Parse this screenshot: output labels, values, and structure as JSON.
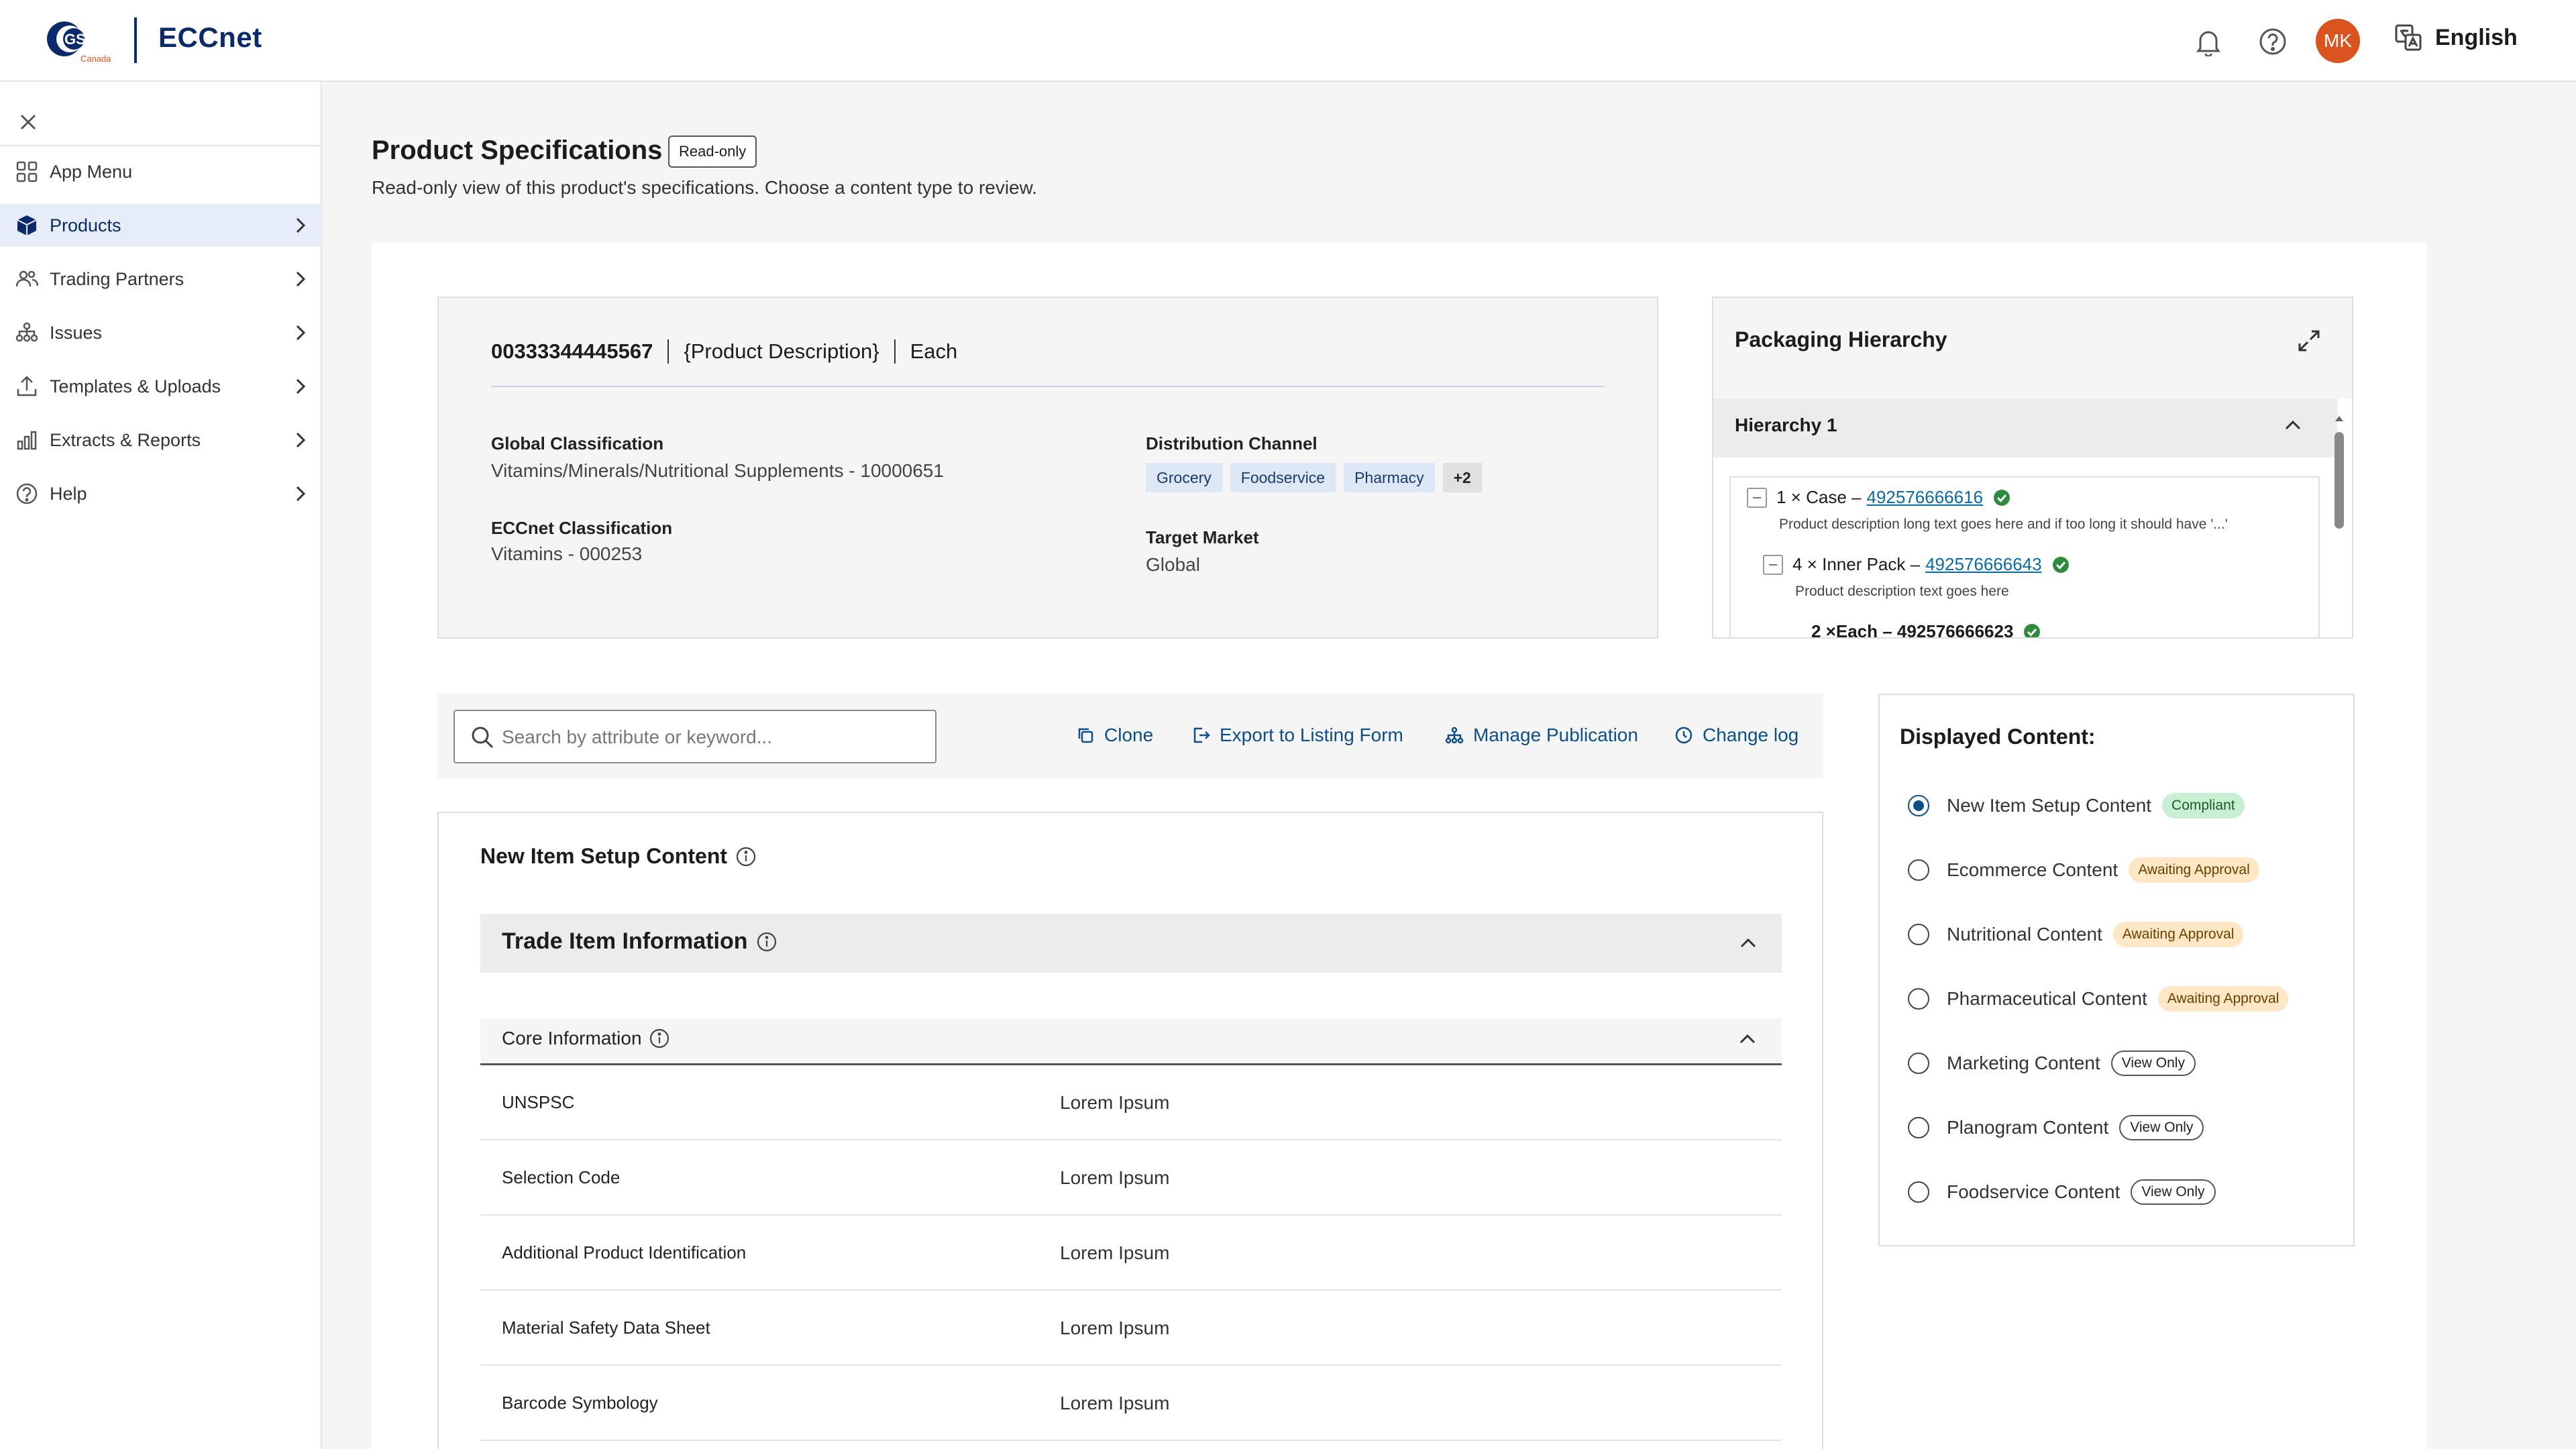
{
  "header": {
    "logo_text": "GS1",
    "logo_sub": "Canada",
    "app_name": "ECCnet",
    "avatar_initials": "MK",
    "language": "English",
    "icons": [
      "bell-icon",
      "help-icon",
      "translate-icon"
    ]
  },
  "sidebar": {
    "items": [
      {
        "label": "App Menu",
        "icon": "grid-icon",
        "has_chevron": false
      },
      {
        "label": "Products",
        "icon": "cube-icon",
        "has_chevron": true,
        "active": true
      },
      {
        "label": "Trading Partners",
        "icon": "users-icon",
        "has_chevron": true
      },
      {
        "label": "Issues",
        "icon": "hierarchy-icon",
        "has_chevron": true
      },
      {
        "label": "Templates & Uploads",
        "icon": "upload-icon",
        "has_chevron": true
      },
      {
        "label": "Extracts & Reports",
        "icon": "chart-icon",
        "has_chevron": true
      },
      {
        "label": "Help",
        "icon": "help-icon",
        "has_chevron": true
      }
    ]
  },
  "page": {
    "title": "Product Specifications",
    "badge": "Read-only",
    "subtitle": "Read-only view of this product's specifications. Choose a content type to review."
  },
  "product": {
    "gtin": "00333344445567",
    "description": "{Product Description}",
    "unit": "Each",
    "global_classification_label": "Global Classification",
    "global_classification_value": "Vitamins/Minerals/Nutritional Supplements - 10000651",
    "eccnet_classification_label": "ECCnet Classification",
    "eccnet_classification_value": "Vitamins - 000253",
    "distribution_channel_label": "Distribution Channel",
    "distribution_channels": [
      "Grocery",
      "Foodservice",
      "Pharmacy"
    ],
    "distribution_more": "+2",
    "target_market_label": "Target Market",
    "target_market_value": "Global"
  },
  "packaging": {
    "title": "Packaging Hierarchy",
    "hierarchy_label": "Hierarchy 1",
    "case_prefix": "1 × Case –",
    "case_gtin": "492576666616",
    "case_desc": "Product description long text goes here and if too long it should have '...'",
    "inner_prefix": "4 × Inner Pack –",
    "inner_gtin": "492576666643",
    "inner_desc": "Product description text goes here",
    "each_text": "2 ×Each – 492576666623"
  },
  "toolbar": {
    "search_placeholder": "Search by attribute or keyword...",
    "clone": "Clone",
    "export": "Export to Listing Form",
    "manage": "Manage Publication",
    "changelog": "Change log"
  },
  "content": {
    "title": "New Item Setup Content",
    "section": "Trade Item Information",
    "subsection": "Core Information",
    "rows": [
      {
        "key": "UNSPSC",
        "value": "Lorem Ipsum"
      },
      {
        "key": "Selection Code",
        "value": "Lorem Ipsum"
      },
      {
        "key": "Additional Product Identification",
        "value": "Lorem Ipsum"
      },
      {
        "key": "Material Safety Data Sheet",
        "value": "Lorem Ipsum"
      },
      {
        "key": "Barcode Symbology",
        "value": "Lorem Ipsum"
      }
    ]
  },
  "displayed_content": {
    "title": "Displayed Content:",
    "options": [
      {
        "label": "New Item Setup Content",
        "badge": "Compliant",
        "badge_type": "compliant",
        "selected": true
      },
      {
        "label": "Ecommerce Content",
        "badge": "Awaiting Approval",
        "badge_type": "awaiting",
        "selected": false
      },
      {
        "label": "Nutritional Content",
        "badge": "Awaiting Approval",
        "badge_type": "awaiting",
        "selected": false
      },
      {
        "label": "Pharmaceutical Content",
        "badge": "Awaiting Approval",
        "badge_type": "awaiting",
        "selected": false
      },
      {
        "label": "Marketing Content",
        "badge": "View Only",
        "badge_type": "view",
        "selected": false
      },
      {
        "label": "Planogram Content",
        "badge": "View Only",
        "badge_type": "view",
        "selected": false
      },
      {
        "label": "Foodservice Content",
        "badge": "View Only",
        "badge_type": "view",
        "selected": false
      }
    ]
  },
  "colors": {
    "brand_navy": "#0b2a6b",
    "link": "#0a6aa8",
    "avatar": "#d9541e",
    "success": "#2e8b3e"
  }
}
